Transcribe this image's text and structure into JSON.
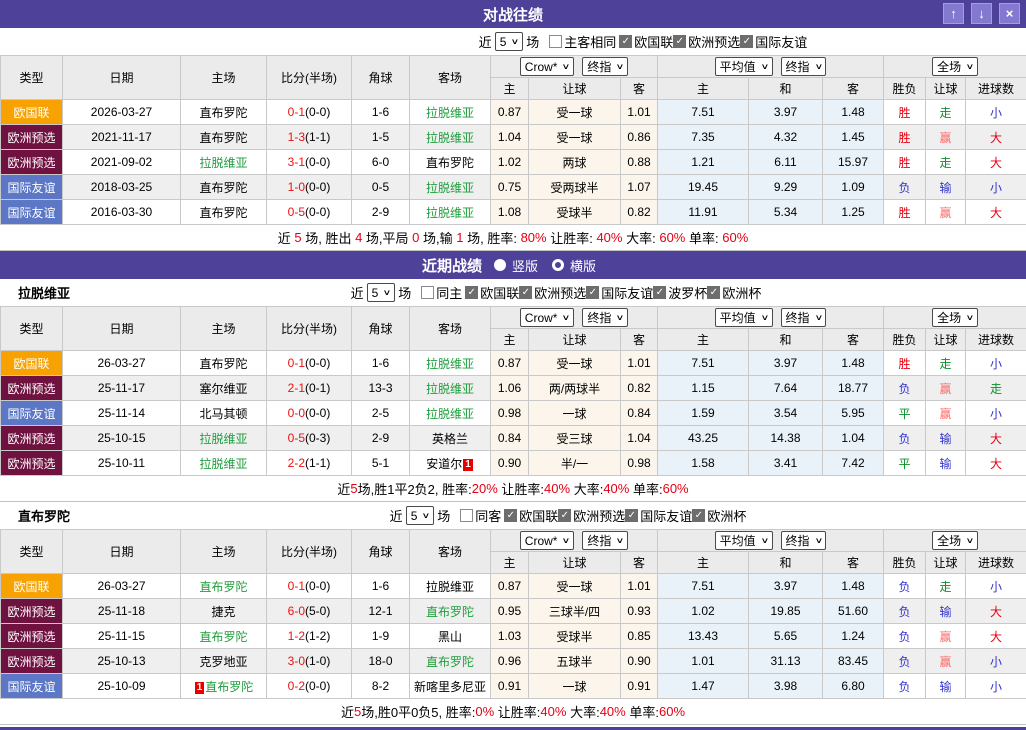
{
  "icons": {
    "check": "✓",
    "chevron": "∨",
    "up": "↑",
    "down": "↓",
    "close": "×"
  },
  "h2h_bar": {
    "title": "对战往绩"
  },
  "recent_bar": {
    "title": "近期战绩",
    "radio_vertical": "竖版",
    "radio_horizontal": "横版"
  },
  "table_header": {
    "col_type": "类型",
    "col_date": "日期",
    "col_home": "主场",
    "col_score": "比分(半场)",
    "col_corner": "角球",
    "col_away": "客场",
    "sub_home": "主",
    "sub_handicap": "让球",
    "sub_away": "客",
    "sub_avg_home": "主",
    "sub_avg_draw": "和",
    "sub_avg_away": "客",
    "col_result": "胜负",
    "col_let": "让球",
    "col_goals": "进球数",
    "sel_odds_source": "Crow*",
    "sel_odds_kind": "终指",
    "sel_avg": "平均值",
    "sel_avg_kind": "终指",
    "sel_scope": "全场"
  },
  "s1": {
    "filter": {
      "near": "近",
      "count": "5",
      "games": "场",
      "toggle": "主客相同",
      "leagues": [
        "欧国联",
        "欧洲预选",
        "国际友谊"
      ]
    },
    "rows": [
      {
        "tc": "t-orange",
        "type": "欧国联",
        "date": "2026-03-27",
        "home": "直布罗陀",
        "home_c": "",
        "ft": "0-1",
        "ht": "(0-0)",
        "corner": "1-6",
        "away": "拉脱维亚",
        "away_c": "c-team",
        "h": "0.87",
        "hc": "受一球",
        "a": "1.01",
        "ah": "7.51",
        "ad": "3.97",
        "aa": "1.48",
        "res": "胜",
        "res_c": "c-red",
        "let": "走",
        "let_c": "c-green",
        "goal": "小",
        "goal_c": "c-blue"
      },
      {
        "tc": "t-maroon",
        "type": "欧洲预选",
        "date": "2021-11-17",
        "home": "直布罗陀",
        "home_c": "",
        "ft": "1-3",
        "ht": "(1-1)",
        "corner": "1-5",
        "away": "拉脱维亚",
        "away_c": "c-team",
        "h": "1.04",
        "hc": "受一球",
        "a": "0.86",
        "ah": "7.35",
        "ad": "4.32",
        "aa": "1.45",
        "res": "胜",
        "res_c": "c-red",
        "let": "赢",
        "let_c": "c-pink",
        "goal": "大",
        "goal_c": "c-red"
      },
      {
        "tc": "t-maroon",
        "type": "欧洲预选",
        "date": "2021-09-02",
        "home": "拉脱维亚",
        "home_c": "c-team",
        "ft": "3-1",
        "ht": "(0-0)",
        "corner": "6-0",
        "away": "直布罗陀",
        "away_c": "",
        "h": "1.02",
        "hc": "两球",
        "a": "0.88",
        "ah": "1.21",
        "ad": "6.11",
        "aa": "15.97",
        "res": "胜",
        "res_c": "c-red",
        "let": "走",
        "let_c": "c-green",
        "goal": "大",
        "goal_c": "c-red"
      },
      {
        "tc": "t-blue",
        "type": "国际友谊",
        "date": "2018-03-25",
        "home": "直布罗陀",
        "home_c": "",
        "ft": "1-0",
        "ht": "(0-0)",
        "corner": "0-5",
        "away": "拉脱维亚",
        "away_c": "c-team",
        "h": "0.75",
        "hc": "受两球半",
        "a": "1.07",
        "ah": "19.45",
        "ad": "9.29",
        "aa": "1.09",
        "res": "负",
        "res_c": "c-blue",
        "let": "输",
        "let_c": "c-blue",
        "goal": "小",
        "goal_c": "c-blue"
      },
      {
        "tc": "t-blue",
        "type": "国际友谊",
        "date": "2016-03-30",
        "home": "直布罗陀",
        "home_c": "",
        "ft": "0-5",
        "ht": "(0-0)",
        "corner": "2-9",
        "away": "拉脱维亚",
        "away_c": "c-team",
        "h": "1.08",
        "hc": "受球半",
        "a": "0.82",
        "ah": "11.91",
        "ad": "5.34",
        "aa": "1.25",
        "res": "胜",
        "res_c": "c-red",
        "let": "赢",
        "let_c": "c-pink",
        "goal": "大",
        "goal_c": "c-red"
      }
    ],
    "summary": [
      {
        "t": "近 "
      },
      {
        "t": "5",
        "c": "c-red"
      },
      {
        "t": " 场, 胜出 "
      },
      {
        "t": "4",
        "c": "c-red"
      },
      {
        "t": " 场,平局 "
      },
      {
        "t": "0",
        "c": "c-red"
      },
      {
        "t": " 场,输 "
      },
      {
        "t": "1",
        "c": "c-red"
      },
      {
        "t": " 场, 胜率: "
      },
      {
        "t": "80%",
        "c": "c-red"
      },
      {
        "t": " 让胜率: "
      },
      {
        "t": "40%",
        "c": "c-red"
      },
      {
        "t": " 大率: "
      },
      {
        "t": "60%",
        "c": "c-red"
      },
      {
        "t": " 单率: "
      },
      {
        "t": "60%",
        "c": "c-red"
      }
    ]
  },
  "s2": {
    "team": "拉脱维亚",
    "filter": {
      "near": "近",
      "count": "5",
      "games": "场",
      "toggle": "同主",
      "leagues": [
        "欧国联",
        "欧洲预选",
        "国际友谊",
        "波罗杯",
        "欧洲杯"
      ]
    },
    "rows": [
      {
        "tc": "t-orange",
        "type": "欧国联",
        "date": "26-03-27",
        "home": "直布罗陀",
        "home_c": "",
        "ft": "0-1",
        "ht": "(0-0)",
        "corner": "1-6",
        "away": "拉脱维亚",
        "away_c": "c-team",
        "h": "0.87",
        "hc": "受一球",
        "a": "1.01",
        "ah": "7.51",
        "ad": "3.97",
        "aa": "1.48",
        "res": "胜",
        "res_c": "c-red",
        "let": "走",
        "let_c": "c-green",
        "goal": "小",
        "goal_c": "c-blue"
      },
      {
        "tc": "t-maroon",
        "type": "欧洲预选",
        "date": "25-11-17",
        "home": "塞尔维亚",
        "home_c": "",
        "ft": "2-1",
        "ht": "(0-1)",
        "corner": "13-3",
        "away": "拉脱维亚",
        "away_c": "c-team",
        "h": "1.06",
        "hc": "两/两球半",
        "a": "0.82",
        "ah": "1.15",
        "ad": "7.64",
        "aa": "18.77",
        "res": "负",
        "res_c": "c-blue",
        "let": "赢",
        "let_c": "c-pink",
        "goal": "走",
        "goal_c": "c-green"
      },
      {
        "tc": "t-blue",
        "type": "国际友谊",
        "date": "25-11-14",
        "home": "北马其顿",
        "home_c": "",
        "ft": "0-0",
        "ht": "(0-0)",
        "corner": "2-5",
        "away": "拉脱维亚",
        "away_c": "c-team",
        "h": "0.98",
        "hc": "一球",
        "a": "0.84",
        "ah": "1.59",
        "ad": "3.54",
        "aa": "5.95",
        "res": "平",
        "res_c": "c-green",
        "let": "赢",
        "let_c": "c-pink",
        "goal": "小",
        "goal_c": "c-blue"
      },
      {
        "tc": "t-maroon",
        "type": "欧洲预选",
        "date": "25-10-15",
        "home": "拉脱维亚",
        "home_c": "c-team",
        "ft": "0-5",
        "ht": "(0-3)",
        "corner": "2-9",
        "away": "英格兰",
        "away_c": "",
        "h": "0.84",
        "hc": "受三球",
        "a": "1.04",
        "ah": "43.25",
        "ad": "14.38",
        "aa": "1.04",
        "res": "负",
        "res_c": "c-blue",
        "let": "输",
        "let_c": "c-blue",
        "goal": "大",
        "goal_c": "c-red"
      },
      {
        "tc": "t-maroon",
        "type": "欧洲预选",
        "date": "25-10-11",
        "home": "拉脱维亚",
        "home_c": "c-team",
        "ft": "2-2",
        "ht": "(1-1)",
        "corner": "5-1",
        "away": "安道尔",
        "away_c": "",
        "away_badge": "1",
        "h": "0.90",
        "hc": "半/一",
        "a": "0.98",
        "ah": "1.58",
        "ad": "3.41",
        "aa": "7.42",
        "res": "平",
        "res_c": "c-green",
        "let": "输",
        "let_c": "c-blue",
        "goal": "大",
        "goal_c": "c-red"
      }
    ],
    "summary": [
      {
        "t": "近"
      },
      {
        "t": "5",
        "c": "c-red"
      },
      {
        "t": "场,胜1平2负2, 胜率:"
      },
      {
        "t": "20%",
        "c": "c-red"
      },
      {
        "t": " 让胜率:"
      },
      {
        "t": "40%",
        "c": "c-red"
      },
      {
        "t": " 大率:"
      },
      {
        "t": "40%",
        "c": "c-red"
      },
      {
        "t": " 单率:"
      },
      {
        "t": "60%",
        "c": "c-red"
      }
    ]
  },
  "s3": {
    "team": "直布罗陀",
    "filter": {
      "near": "近",
      "count": "5",
      "games": "场",
      "toggle": "同客",
      "leagues": [
        "欧国联",
        "欧洲预选",
        "国际友谊",
        "欧洲杯"
      ]
    },
    "rows": [
      {
        "tc": "t-orange",
        "type": "欧国联",
        "date": "26-03-27",
        "home": "直布罗陀",
        "home_c": "c-team",
        "ft": "0-1",
        "ht": "(0-0)",
        "corner": "1-6",
        "away": "拉脱维亚",
        "away_c": "",
        "h": "0.87",
        "hc": "受一球",
        "a": "1.01",
        "ah": "7.51",
        "ad": "3.97",
        "aa": "1.48",
        "res": "负",
        "res_c": "c-blue",
        "let": "走",
        "let_c": "c-green",
        "goal": "小",
        "goal_c": "c-blue"
      },
      {
        "tc": "t-maroon",
        "type": "欧洲预选",
        "date": "25-11-18",
        "home": "捷克",
        "home_c": "",
        "ft": "6-0",
        "ht": "(5-0)",
        "corner": "12-1",
        "away": "直布罗陀",
        "away_c": "c-team",
        "h": "0.95",
        "hc": "三球半/四",
        "a": "0.93",
        "ah": "1.02",
        "ad": "19.85",
        "aa": "51.60",
        "res": "负",
        "res_c": "c-blue",
        "let": "输",
        "let_c": "c-blue",
        "goal": "大",
        "goal_c": "c-red"
      },
      {
        "tc": "t-maroon",
        "type": "欧洲预选",
        "date": "25-11-15",
        "home": "直布罗陀",
        "home_c": "c-team",
        "ft": "1-2",
        "ht": "(1-2)",
        "corner": "1-9",
        "away": "黑山",
        "away_c": "",
        "h": "1.03",
        "hc": "受球半",
        "a": "0.85",
        "ah": "13.43",
        "ad": "5.65",
        "aa": "1.24",
        "res": "负",
        "res_c": "c-blue",
        "let": "赢",
        "let_c": "c-pink",
        "goal": "大",
        "goal_c": "c-red"
      },
      {
        "tc": "t-maroon",
        "type": "欧洲预选",
        "date": "25-10-13",
        "home": "克罗地亚",
        "home_c": "",
        "ft": "3-0",
        "ht": "(1-0)",
        "corner": "18-0",
        "away": "直布罗陀",
        "away_c": "c-team",
        "h": "0.96",
        "hc": "五球半",
        "a": "0.90",
        "ah": "1.01",
        "ad": "31.13",
        "aa": "83.45",
        "res": "负",
        "res_c": "c-blue",
        "let": "赢",
        "let_c": "c-pink",
        "goal": "小",
        "goal_c": "c-blue"
      },
      {
        "tc": "t-blue",
        "type": "国际友谊",
        "date": "25-10-09",
        "home": "直布罗陀",
        "home_c": "c-team",
        "home_badge": "1",
        "ft": "0-2",
        "ht": "(0-0)",
        "corner": "8-2",
        "away": "新喀里多尼亚",
        "away_c": "",
        "h": "0.91",
        "hc": "一球",
        "a": "0.91",
        "ah": "1.47",
        "ad": "3.98",
        "aa": "6.80",
        "res": "负",
        "res_c": "c-blue",
        "let": "输",
        "let_c": "c-blue",
        "goal": "小",
        "goal_c": "c-blue"
      }
    ],
    "summary": [
      {
        "t": "近"
      },
      {
        "t": "5",
        "c": "c-red"
      },
      {
        "t": "场,胜0平0负5, 胜率:"
      },
      {
        "t": "0%",
        "c": "c-red"
      },
      {
        "t": " 让胜率:"
      },
      {
        "t": "40%",
        "c": "c-red"
      },
      {
        "t": " 大率:"
      },
      {
        "t": "40%",
        "c": "c-red"
      },
      {
        "t": " 单率:"
      },
      {
        "t": "60%",
        "c": "c-red"
      }
    ]
  }
}
